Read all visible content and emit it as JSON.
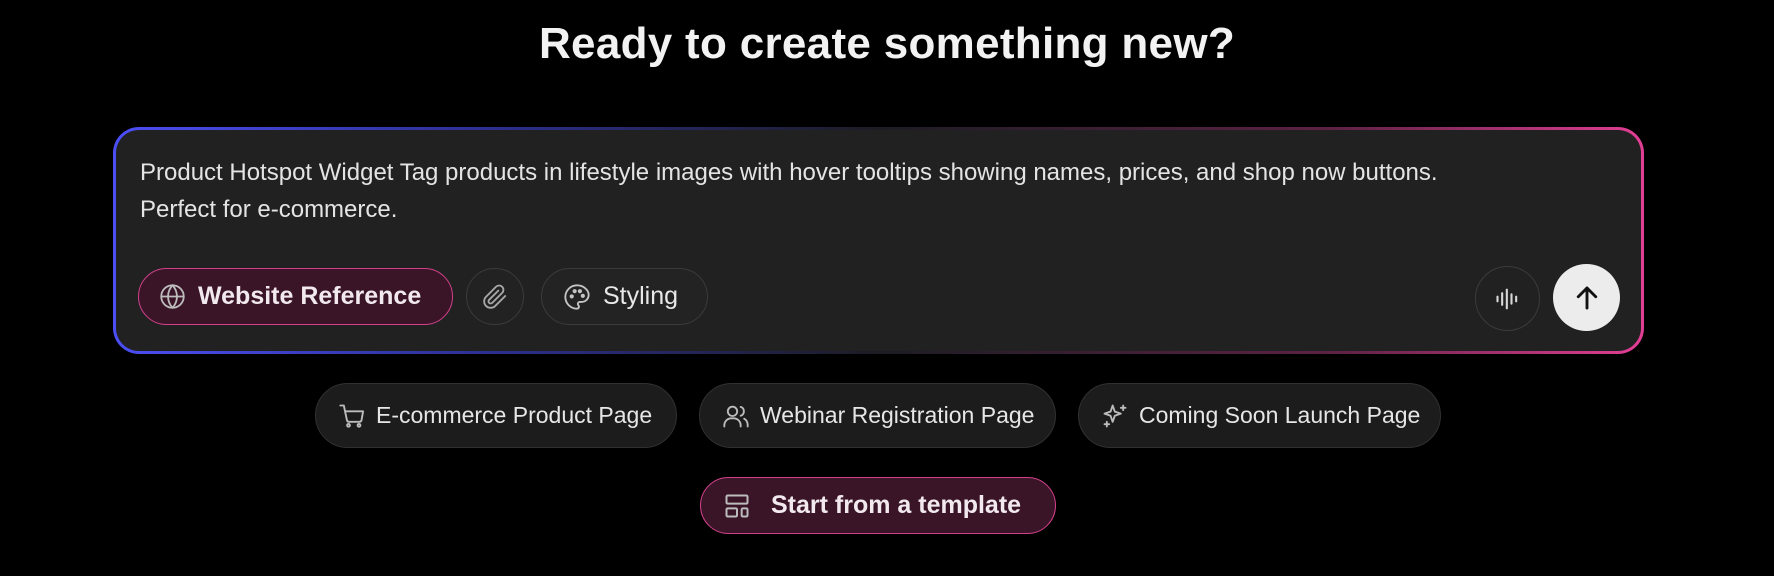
{
  "headline": "Ready to create something new?",
  "composer": {
    "prompt": "Product Hotspot Widget Tag products in lifestyle images with hover tooltips showing names, prices, and shop now buttons.\nPerfect for e-commerce.",
    "website_reference_label": "Website Reference",
    "styling_label": "Styling",
    "icons": {
      "website_reference": "globe-icon",
      "attach": "paperclip-icon",
      "styling": "palette-icon",
      "voice": "audio-waveform-icon",
      "send": "arrow-up-icon"
    }
  },
  "suggestions": [
    {
      "label": "E-commerce Product Page",
      "icon": "shopping-cart-icon"
    },
    {
      "label": "Webinar Registration Page",
      "icon": "users-icon"
    },
    {
      "label": "Coming Soon Launch Page",
      "icon": "sparkles-icon"
    }
  ],
  "template_button": {
    "label": "Start from a template",
    "icon": "layout-template-icon"
  },
  "colors": {
    "background": "#000000",
    "composer_bg": "#212121",
    "accent_pink": "#d2408a",
    "accent_blue": "#4b4ef5",
    "pill_pink_bg": "#3a1528",
    "send_button_bg": "#ececec"
  }
}
